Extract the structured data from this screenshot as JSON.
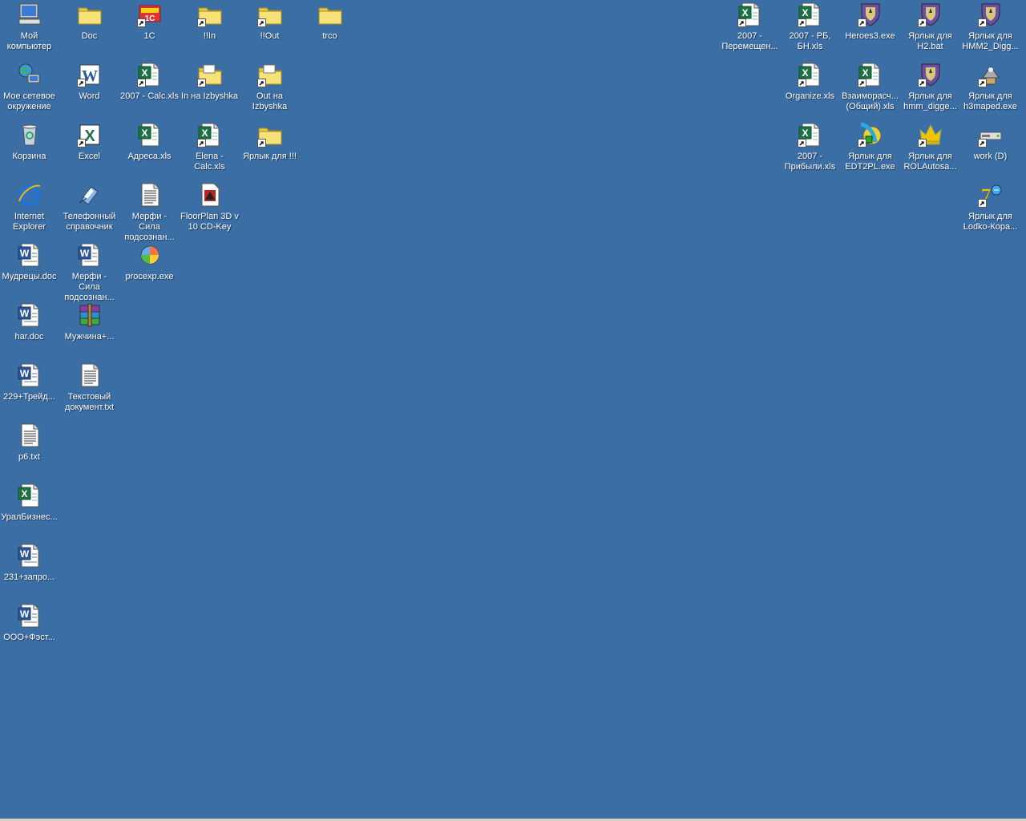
{
  "desktop": {
    "background": "#3A6EA5",
    "icons": [
      {
        "label": "Мой компьютер",
        "icon": "my-computer-icon",
        "shortcut": false
      },
      {
        "label": "Doc",
        "icon": "folder-icon",
        "shortcut": false
      },
      {
        "label": "1C",
        "icon": "1c-app-icon",
        "shortcut": true
      },
      {
        "label": "!!In",
        "icon": "folder-icon",
        "shortcut": true
      },
      {
        "label": "!!Out",
        "icon": "folder-icon",
        "shortcut": true
      },
      {
        "label": "trco",
        "icon": "folder-icon",
        "shortcut": false
      },
      {
        "label": "2007 - Перемещен...",
        "icon": "excel-document-icon",
        "shortcut": true
      },
      {
        "label": "2007 - РБ, БН.xls",
        "icon": "excel-document-icon",
        "shortcut": true
      },
      {
        "label": "Heroes3.exe",
        "icon": "heroes-shield-icon",
        "shortcut": true
      },
      {
        "label": "Ярлык для H2.bat",
        "icon": "heroes-shield-icon",
        "shortcut": true
      },
      {
        "label": "Ярлык для HMM2_Digg...",
        "icon": "heroes-shield-icon",
        "shortcut": true
      },
      {
        "label": "Мое сетевое окружение",
        "icon": "network-places-icon",
        "shortcut": false
      },
      {
        "label": "Word",
        "icon": "word-app-icon",
        "shortcut": true
      },
      {
        "label": "2007 - Calc.xls",
        "icon": "excel-document-icon",
        "shortcut": true
      },
      {
        "label": "In на Izbyshka",
        "icon": "shared-folder-icon",
        "shortcut": true
      },
      {
        "label": "Out на Izbyshka",
        "icon": "shared-folder-icon",
        "shortcut": true
      },
      {
        "label": "Organize.xls",
        "icon": "excel-document-icon",
        "shortcut": true
      },
      {
        "label": "Взаиморасч... (Общий).xls",
        "icon": "excel-document-icon",
        "shortcut": true
      },
      {
        "label": "Ярлык для hmm_digge...",
        "icon": "heroes-shield-icon",
        "shortcut": true
      },
      {
        "label": "Ярлык для h3maped.exe",
        "icon": "map-editor-icon",
        "shortcut": true
      },
      {
        "label": "Корзина",
        "icon": "recycle-bin-icon",
        "shortcut": false
      },
      {
        "label": "Excel",
        "icon": "excel-app-icon",
        "shortcut": true
      },
      {
        "label": "Адреса.xls",
        "icon": "excel-document-icon",
        "shortcut": false
      },
      {
        "label": "Elena - Calc.xls",
        "icon": "excel-document-icon",
        "shortcut": true
      },
      {
        "label": "Ярлык для !!!",
        "icon": "folder-icon",
        "shortcut": true
      },
      {
        "label": "2007 - Прибыли.xls",
        "icon": "excel-document-icon",
        "shortcut": true
      },
      {
        "label": "Ярлык для EDT2PL.exe",
        "icon": "quill-editor-icon",
        "shortcut": true
      },
      {
        "label": "Ярлык для ROLAutosa...",
        "icon": "crown-icon",
        "shortcut": true
      },
      {
        "label": "work (D)",
        "icon": "drive-icon",
        "shortcut": true
      },
      {
        "label": "Internet Explorer",
        "icon": "internet-explorer-icon",
        "shortcut": false
      },
      {
        "label": "Телефонный справочник",
        "icon": "phonebook-icon",
        "shortcut": false
      },
      {
        "label": "Мерфи - Сила подсознан...",
        "icon": "text-document-icon",
        "shortcut": false
      },
      {
        "label": "FloorPlan 3D v 10 CD-Key",
        "icon": "floorplan-document-icon",
        "shortcut": false
      },
      {
        "label": "Ярлык для Lodko-Кора...",
        "icon": "lottery-icon",
        "shortcut": true
      },
      {
        "label": "Мудрецы.doc",
        "icon": "word-document-icon",
        "shortcut": false
      },
      {
        "label": "Мерфи - Сила подсознан...",
        "icon": "word-document-icon",
        "shortcut": false
      },
      {
        "label": "procexp.exe",
        "icon": "process-explorer-icon",
        "shortcut": false
      },
      {
        "label": "har.doc",
        "icon": "word-document-icon",
        "shortcut": false
      },
      {
        "label": "Мужчина+...",
        "icon": "winrar-archive-icon",
        "shortcut": false
      },
      {
        "label": "229+Трейд...",
        "icon": "word-document-icon",
        "shortcut": false
      },
      {
        "label": "Текстовый документ.txt",
        "icon": "text-document-icon",
        "shortcut": false
      },
      {
        "label": "p6.txt",
        "icon": "text-document-icon",
        "shortcut": false
      },
      {
        "label": "УралБизнес...",
        "icon": "excel-document-icon",
        "shortcut": false
      },
      {
        "label": "231+запро...",
        "icon": "word-document-icon",
        "shortcut": false
      },
      {
        "label": "ООО+Фэст...",
        "icon": "word-document-icon",
        "shortcut": false
      }
    ]
  }
}
